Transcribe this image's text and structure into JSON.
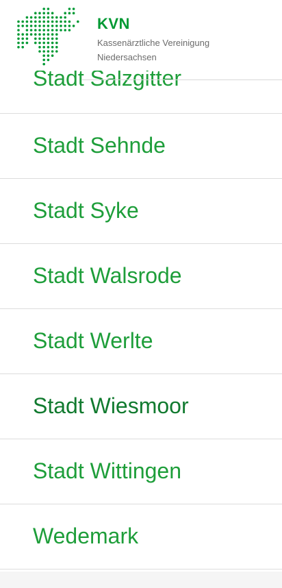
{
  "colors": {
    "brand_green": "#009933",
    "link_green": "#1e9e3a",
    "visited_green": "#117a2f",
    "subtitle_gray": "#6b6b6b"
  },
  "header": {
    "brand_name": "KVN",
    "brand_line1": "Kassenärztliche Vereinigung",
    "brand_line2": "Niedersachsen",
    "logo_icon": "kvn-dotted-map-logo"
  },
  "list": {
    "items": [
      {
        "label": "Stadt Salzgitter"
      },
      {
        "label": "Stadt Sehnde"
      },
      {
        "label": "Stadt Syke"
      },
      {
        "label": "Stadt Walsrode"
      },
      {
        "label": "Stadt Werlte"
      },
      {
        "label": "Stadt Wiesmoor"
      },
      {
        "label": "Stadt Wittingen"
      },
      {
        "label": "Wedemark"
      }
    ]
  }
}
